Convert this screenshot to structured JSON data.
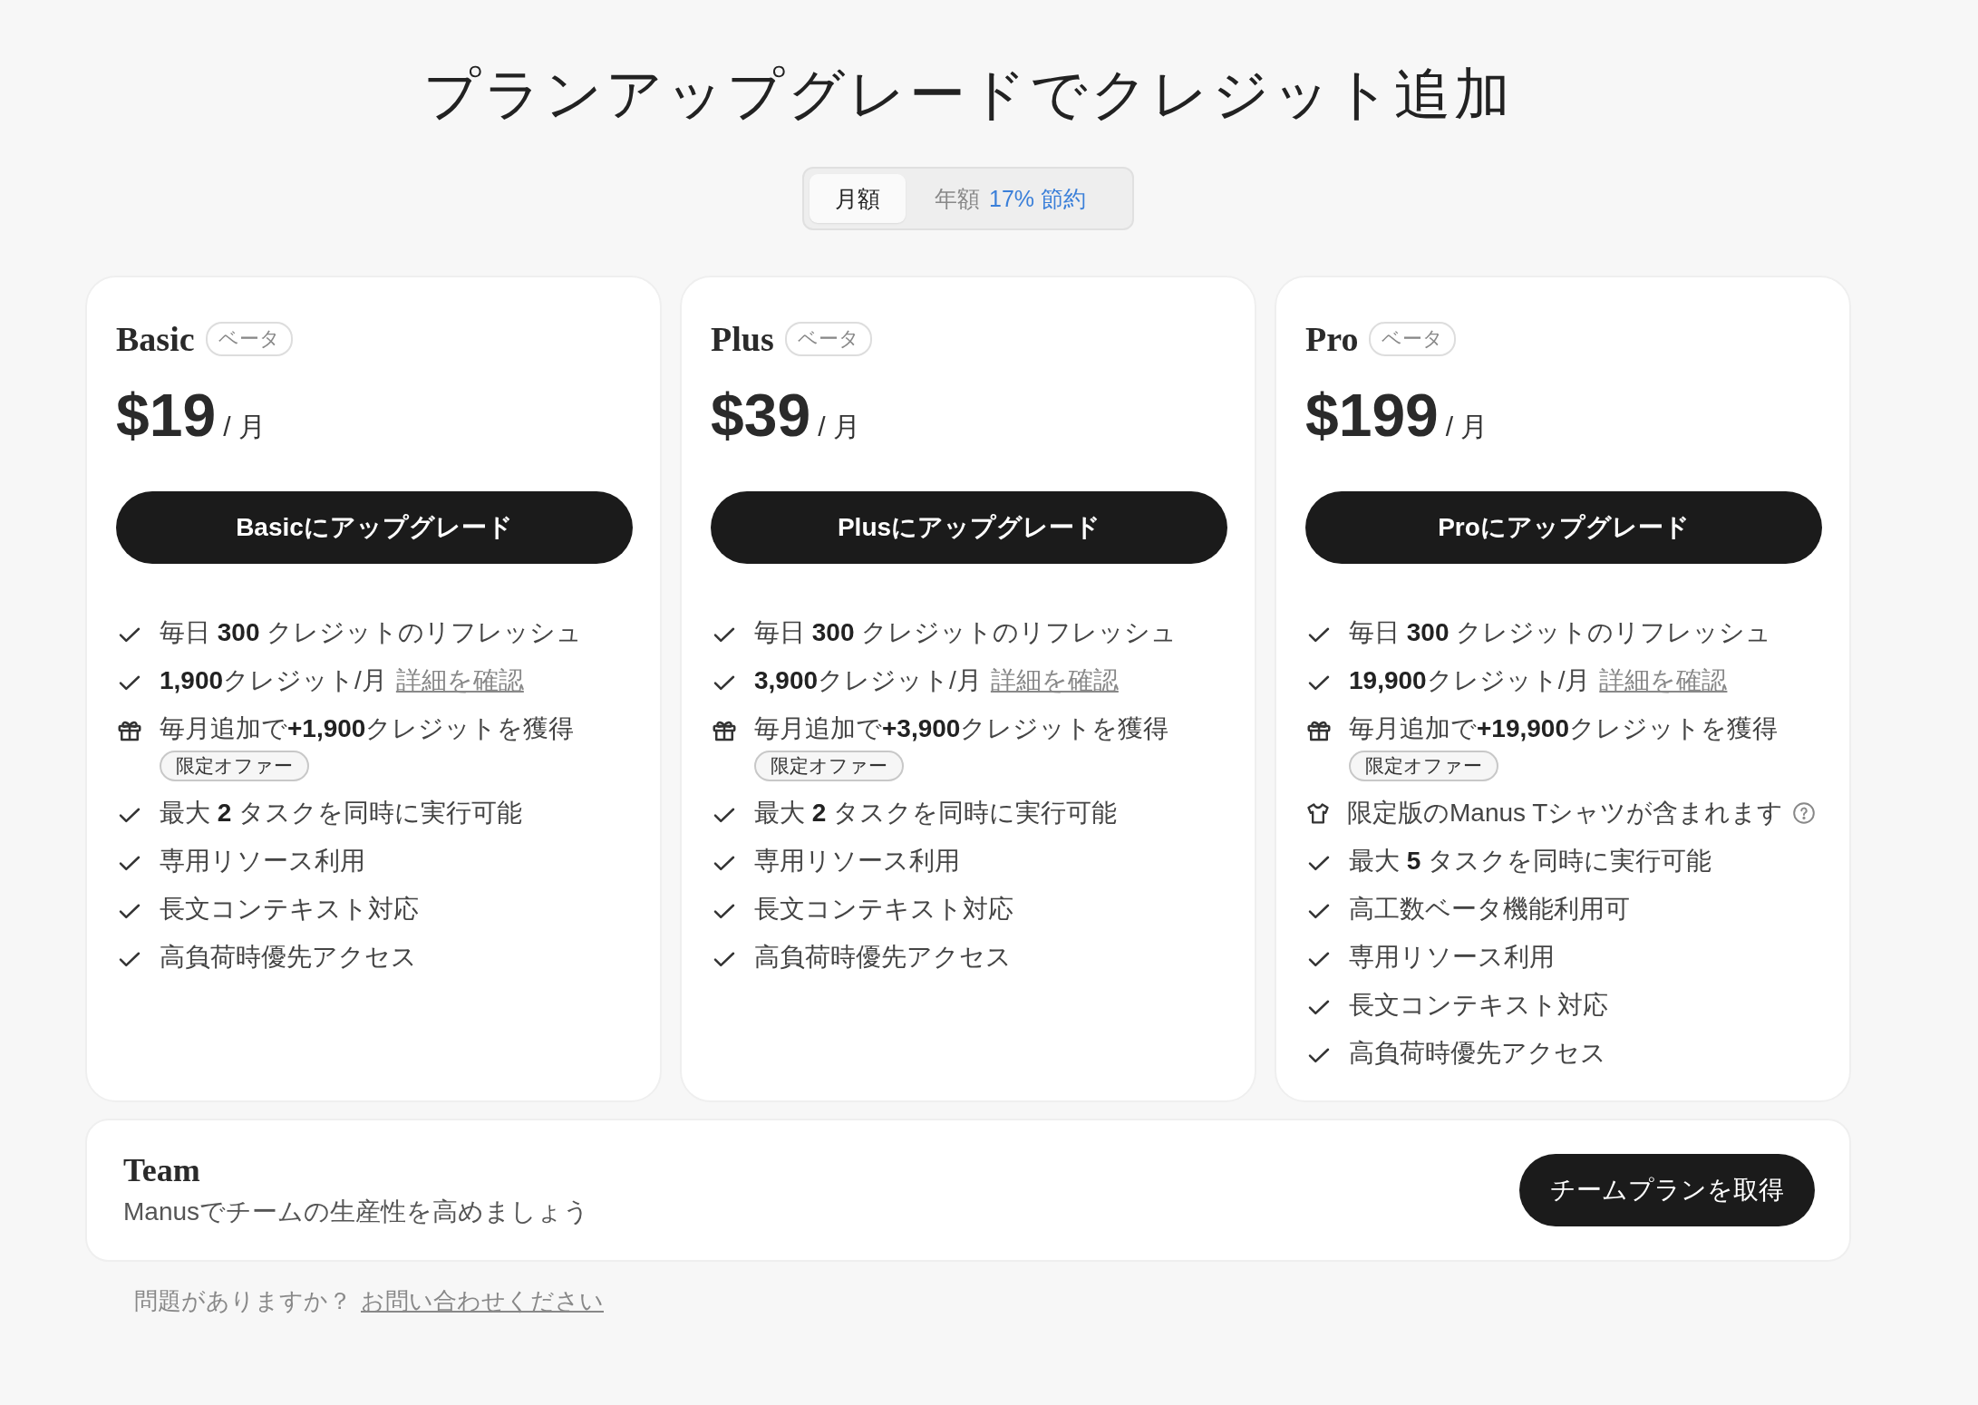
{
  "title": "プランアップグレードでクレジット追加",
  "billing_toggle": [
    {
      "label": "月額",
      "selected": true
    },
    {
      "label": "年額",
      "note": "17% 節約",
      "selected": false
    }
  ],
  "plans": [
    {
      "name": "Basic",
      "tag": "ベータ",
      "price": "$19",
      "period": "/ 月",
      "button": "Basicにアップグレード",
      "features": [
        {
          "kind": "check",
          "text": "毎日 **300** クレジットのリフレッシュ"
        },
        {
          "kind": "check",
          "text": "**1,900**クレジット/月",
          "link": "詳細を確認"
        },
        {
          "kind": "gift",
          "text": "毎月追加で**+1,900**クレジットを獲得",
          "badge": "限定オファー"
        },
        {
          "kind": "check",
          "text": "最大 **2** タスクを同時に実行可能"
        },
        {
          "kind": "check",
          "text": "専用リソース利用"
        },
        {
          "kind": "check",
          "text": "長文コンテキスト対応"
        },
        {
          "kind": "check",
          "text": "高負荷時優先アクセス"
        }
      ]
    },
    {
      "name": "Plus",
      "tag": "ベータ",
      "price": "$39",
      "period": "/ 月",
      "button": "Plusにアップグレード",
      "features": [
        {
          "kind": "check",
          "text": "毎日 **300** クレジットのリフレッシュ"
        },
        {
          "kind": "check",
          "text": "**3,900**クレジット/月",
          "link": "詳細を確認"
        },
        {
          "kind": "gift",
          "text": "毎月追加で**+3,900**クレジットを獲得",
          "badge": "限定オファー"
        },
        {
          "kind": "check",
          "text": "最大 **2** タスクを同時に実行可能"
        },
        {
          "kind": "check",
          "text": "専用リソース利用"
        },
        {
          "kind": "check",
          "text": "長文コンテキスト対応"
        },
        {
          "kind": "check",
          "text": "高負荷時優先アクセス"
        }
      ]
    },
    {
      "name": "Pro",
      "tag": "ベータ",
      "price": "$199",
      "period": "/ 月",
      "button": "Proにアップグレード",
      "features": [
        {
          "kind": "check",
          "text": "毎日 **300** クレジットのリフレッシュ"
        },
        {
          "kind": "check",
          "text": "**19,900**クレジット/月",
          "link": "詳細を確認"
        },
        {
          "kind": "gift",
          "text": "毎月追加で**+19,900**クレジットを獲得",
          "badge": "限定オファー"
        },
        {
          "kind": "shirt",
          "text": "限定版のManus Tシャツが含まれます",
          "help": true
        },
        {
          "kind": "check",
          "text": "最大 **5** タスクを同時に実行可能"
        },
        {
          "kind": "check",
          "text": "高工数ベータ機能利用可"
        },
        {
          "kind": "check",
          "text": "専用リソース利用"
        },
        {
          "kind": "check",
          "text": "長文コンテキスト対応"
        },
        {
          "kind": "check",
          "text": "高負荷時優先アクセス"
        }
      ]
    }
  ],
  "team": {
    "name": "Team",
    "description": "Manusでチームの生産性を高めましょう",
    "button": "チームプランを取得"
  },
  "footer": {
    "text": "問題がありますか？",
    "link": "お問い合わせください"
  }
}
